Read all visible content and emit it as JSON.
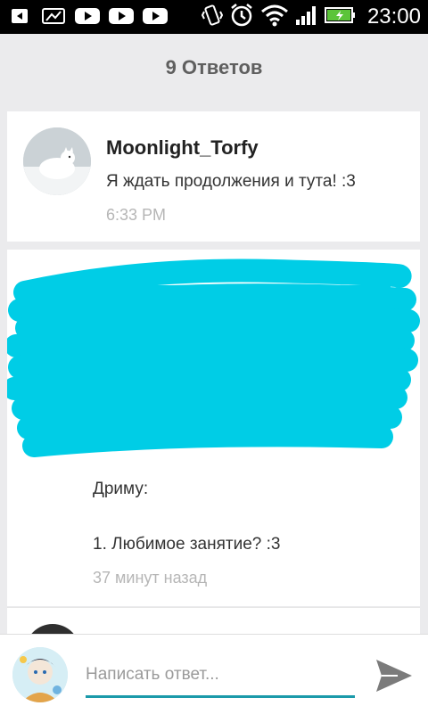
{
  "status_bar": {
    "time": "23:00",
    "left_icons": [
      "back-icon",
      "image-icon",
      "youtube-icon",
      "youtube-icon",
      "youtube-icon"
    ],
    "right_icons": [
      "vibrate-icon",
      "alarm-icon",
      "wifi-icon",
      "signal-icon",
      "battery-icon"
    ]
  },
  "header": {
    "title": "9 Ответов"
  },
  "comments": [
    {
      "author": "Moonlight_Torfy",
      "message": "Я ждать продолжения и тута! :3",
      "time": "6:33 PM"
    },
    {
      "redacted": true,
      "line1": "Дриму:",
      "line2": "1. Любимое занятие? :3",
      "time": "37 минут назад"
    }
  ],
  "reply": {
    "placeholder": "Написать ответ...",
    "value": ""
  },
  "colors": {
    "accent": "#1b9aaa",
    "redaction": "#00cde6",
    "background": "#ebebed"
  }
}
